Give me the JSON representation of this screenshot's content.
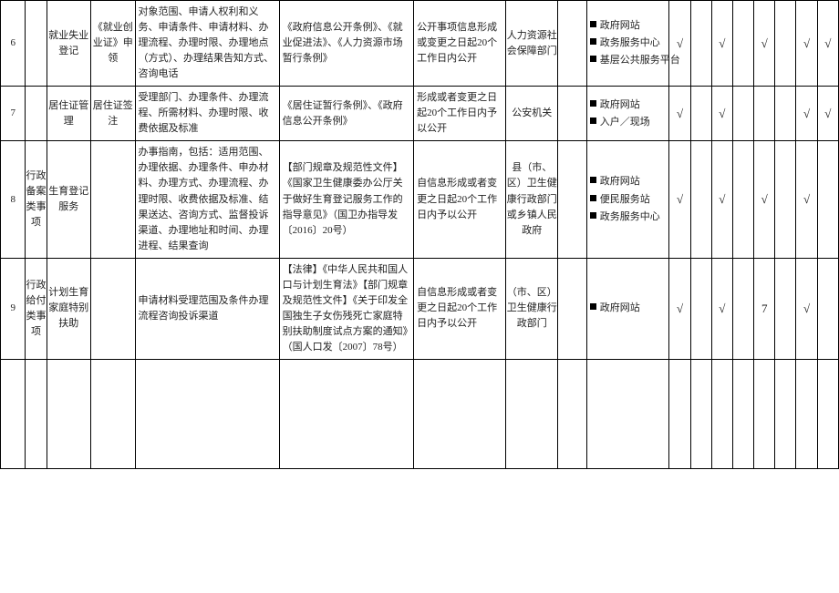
{
  "rows": [
    {
      "no": "6",
      "cat": "",
      "item": "就业失业登记",
      "sub": "《就业创业证》申领",
      "content": "对象范围、申请人权利和义务、申请条件、申请材料、办理流程、办理时限、办理地点（方式）、办理结果告知方式、咨询电话",
      "basis": "《政府信息公开条例》、《就业促进法》、《人力资源市场暂行条例》",
      "time": "公开事项信息形成或变更之日起20个工作日内公开",
      "subj": "人力资源社会保障部门",
      "subj2": "",
      "channels": [
        "政府网站",
        "政务服务中心",
        "基层公共服务平台"
      ],
      "c1": "√",
      "c2": "",
      "c3": "√",
      "c4": "",
      "c5": "√",
      "c6": "",
      "c7": "√",
      "c8": "√"
    },
    {
      "no": "7",
      "cat": "",
      "item": "居住证管理",
      "sub": "居住证签注",
      "content": "受理部门、办理条件、办理流程、所需材料、办理时限、收费依据及标准",
      "basis": "《居住证暂行条例》、《政府信息公开条例》",
      "time": "形成或者变更之日起20个工作日内予以公开",
      "subj": "公安机关",
      "subj2": "",
      "channels": [
        "政府网站",
        "入户／现场"
      ],
      "c1": "√",
      "c2": "",
      "c3": "√",
      "c4": "",
      "c5": "",
      "c6": "",
      "c7": "√",
      "c8": "√"
    },
    {
      "no": "8",
      "cat": "行政备案类事项",
      "item": "生育登记服务",
      "sub": "",
      "content": "办事指南，包括：适用范围、办理依据、办理条件、申办材料、办理方式、办理流程、办理时限、收费依据及标准、结果送达、咨询方式、监督投诉渠道、办理地址和时间、办理进程、结果查询",
      "basis": "【部门规章及规范性文件】《国家卫生健康委办公厅关于做好生育登记服务工作的指导意见》（国卫办指导发〔2016〕20号）",
      "time": "自信息形成或者变更之日起20个工作日内予以公开",
      "subj": "县（市、区）卫生健康行政部门或乡镇人民政府",
      "subj2": "",
      "channels": [
        "政府网站",
        "便民服务站",
        "政务服务中心"
      ],
      "c1": "√",
      "c2": "",
      "c3": "√",
      "c4": "",
      "c5": "√",
      "c6": "",
      "c7": "√",
      "c8": ""
    },
    {
      "no": "9",
      "cat": "行政给付类事项",
      "item": "计划生育家庭特别扶助",
      "sub": "",
      "content": "申请材料受理范围及条件办理流程咨询投诉渠道",
      "basis": "【法律】《中华人民共和国人口与计划生育法》【部门规章及规范性文件】《关于印发全国独生子女伤残死亡家庭特别扶助制度试点方案的通知》（国人口发〔2007〕78号）",
      "time": "自信息形成或者变更之日起20个工作日内予以公开",
      "subj": "（市、区）卫生健康行政部门",
      "subj2": "",
      "channels": [
        "政府网站"
      ],
      "c1": "√",
      "c2": "",
      "c3": "√",
      "c4": "",
      "c5": "7",
      "c6": "",
      "c7": "√",
      "c8": ""
    }
  ]
}
